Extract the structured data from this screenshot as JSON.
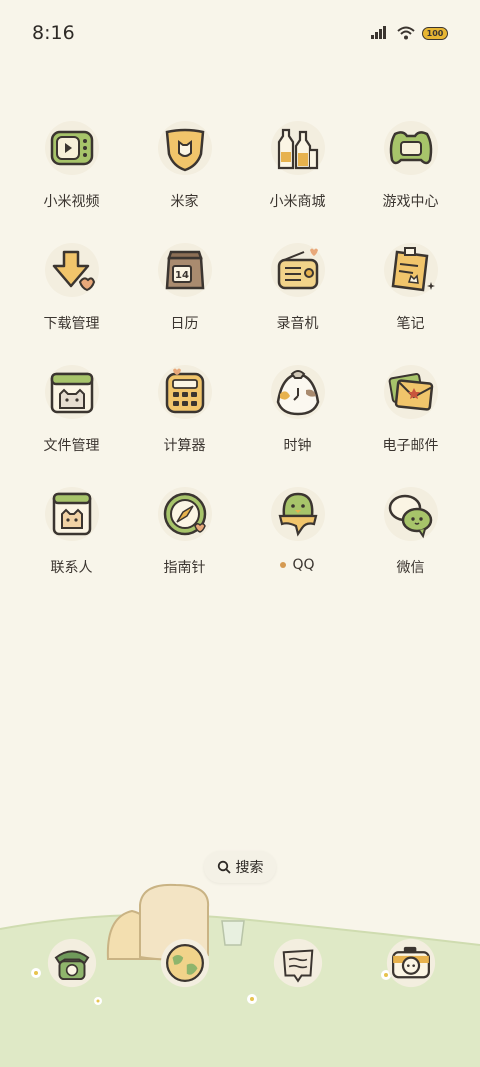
{
  "status_bar": {
    "time": "8:16",
    "battery_level": "100"
  },
  "apps": [
    {
      "label": "小米视频",
      "icon": "tv-icon"
    },
    {
      "label": "米家",
      "icon": "mijia-house-icon"
    },
    {
      "label": "小米商城",
      "icon": "bottles-store-icon"
    },
    {
      "label": "游戏中心",
      "icon": "gamepad-icon"
    },
    {
      "label": "下载管理",
      "icon": "download-arrow-icon"
    },
    {
      "label": "日历",
      "icon": "calendar-bag-icon",
      "day": "14"
    },
    {
      "label": "录音机",
      "icon": "radio-recorder-icon"
    },
    {
      "label": "笔记",
      "icon": "notepad-icon"
    },
    {
      "label": "文件管理",
      "icon": "folder-cat-icon"
    },
    {
      "label": "计算器",
      "icon": "calculator-icon"
    },
    {
      "label": "时钟",
      "icon": "clock-onigiri-icon"
    },
    {
      "label": "电子邮件",
      "icon": "envelope-icon"
    },
    {
      "label": "联系人",
      "icon": "contacts-cat-icon"
    },
    {
      "label": "指南针",
      "icon": "compass-icon"
    },
    {
      "label": "QQ",
      "icon": "qq-penguin-icon",
      "notification_dot": true
    },
    {
      "label": "微信",
      "icon": "wechat-bubbles-icon"
    }
  ],
  "search": {
    "label": "搜索",
    "icon": "search-icon"
  },
  "dock": [
    {
      "icon": "phone-icon"
    },
    {
      "icon": "browser-globe-icon"
    },
    {
      "icon": "messages-icon"
    },
    {
      "icon": "camera-icon"
    }
  ],
  "colors": {
    "background": "#f8f5ea",
    "outline": "#3b3530",
    "green": "#a7c46a",
    "yellow": "#f1d38a",
    "orange": "#e7b24e",
    "grass": "#dfe9c6",
    "notification_dot": "#d59a52"
  }
}
